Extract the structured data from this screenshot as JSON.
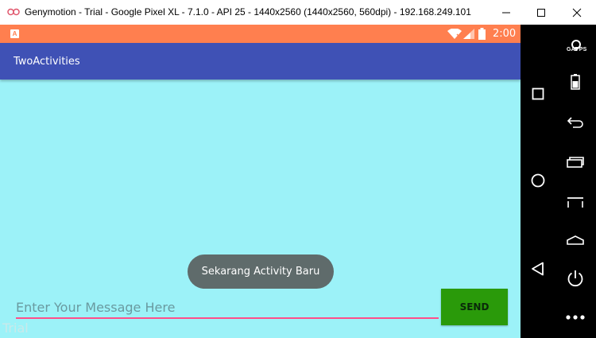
{
  "window": {
    "title": "Genymotion - Trial - Google Pixel XL - 7.1.0 - API 25 - 1440x2560 (1440x2560, 560dpi) - 192.168.249.101",
    "icons": [
      "genymotion-logo",
      "minimize-icon",
      "maximize-icon",
      "close-icon"
    ]
  },
  "status_bar": {
    "time": "2:00",
    "notification_icon_label": "A",
    "icons": [
      "wifi-icon",
      "signal-icon",
      "battery-icon"
    ]
  },
  "app_bar": {
    "title": "TwoActivities"
  },
  "toast": {
    "text": "Sekarang Activity Baru"
  },
  "message": {
    "placeholder": "Enter Your Message Here",
    "value": ""
  },
  "send_button": {
    "label": "SEND"
  },
  "watermark": {
    "text": "Trial"
  },
  "sidebar": {
    "gapps_label": "GAPPS",
    "items": [
      "gapps-icon",
      "battery-icon",
      "back-icon",
      "recent-apps-icon",
      "menu-icon",
      "home-icon",
      "power-icon",
      "more-icon"
    ]
  },
  "nav": {
    "items": [
      "square-icon",
      "circle-icon",
      "triangle-back-icon"
    ]
  },
  "colors": {
    "status_bar": "#ff7f4f",
    "app_bar": "#3f51b5",
    "background": "#9cf2f8",
    "send_button": "#2a9a0a",
    "input_underline": "#ff4f8a",
    "toast": "#5f6b6b"
  }
}
